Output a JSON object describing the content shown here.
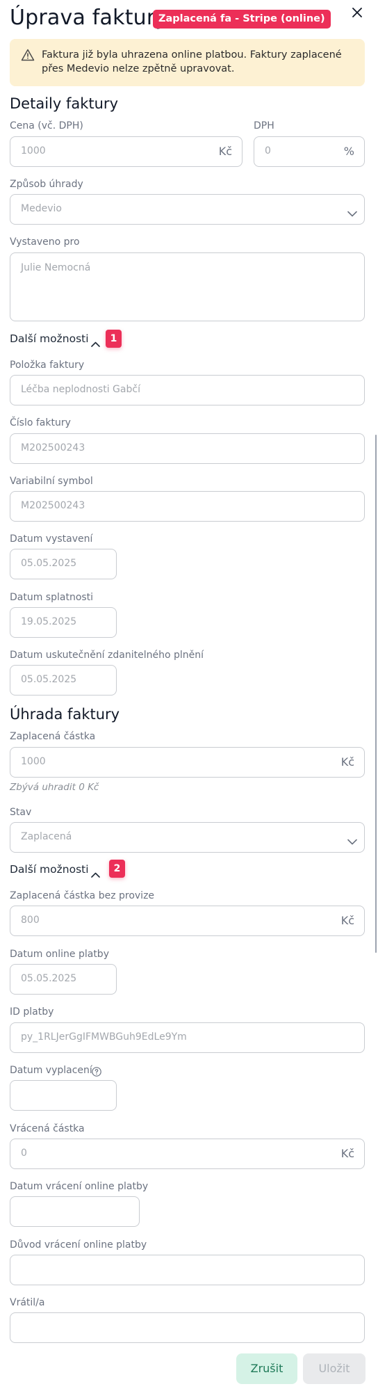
{
  "header": {
    "title": "Úprava faktury",
    "badge": "Zaplacená fa - Stripe (online)"
  },
  "alert": {
    "text": "Faktura již byla uhrazena online platbou. Faktury zaplacené přes Medevio nelze zpětně upravovat."
  },
  "invoice_details": {
    "title": "Detaily faktury",
    "price": {
      "label": "Cena (vč. DPH)",
      "value": "1000",
      "unit": "Kč"
    },
    "vat": {
      "label": "DPH",
      "value": "0",
      "unit": "%"
    },
    "payment_method": {
      "label": "Způsob úhrady",
      "value": "Medevio"
    },
    "issued_for": {
      "label": "Vystaveno pro",
      "value": "Julie Nemocná"
    },
    "more_options": {
      "label": "Další možnosti",
      "marker": "1"
    },
    "item": {
      "label": "Položka faktury",
      "value": "Léčba neplodnosti Gabčí"
    },
    "invoice_number": {
      "label": "Číslo faktury",
      "value": "M202500243"
    },
    "variable_symbol": {
      "label": "Variabilní symbol",
      "value": "M202500243"
    },
    "issue_date": {
      "label": "Datum vystavení",
      "value": "05.05.2025"
    },
    "due_date": {
      "label": "Datum splatnosti",
      "value": "19.05.2025"
    },
    "taxable_date": {
      "label": "Datum uskutečnění zdanitelného plnění",
      "value": "05.05.2025"
    }
  },
  "payment": {
    "title": "Úhrada faktury",
    "paid_amount": {
      "label": "Zaplacená částka",
      "value": "1000",
      "unit": "Kč"
    },
    "remaining": "Zbývá uhradit 0 Kč",
    "status": {
      "label": "Stav",
      "value": "Zaplacená"
    },
    "more_options": {
      "label": "Další možnosti",
      "marker": "2"
    },
    "paid_without_fee": {
      "label": "Zaplacená částka bez provize",
      "value": "800",
      "unit": "Kč"
    },
    "online_payment_date": {
      "label": "Datum online platby",
      "value": "05.05.2025"
    },
    "payment_id": {
      "label": "ID platby",
      "value": "py_1RLJerGgIFMWBGuh9EdLe9Ym"
    },
    "payout_date": {
      "label": "Datum vyplacení",
      "value": ""
    },
    "refunded_amount": {
      "label": "Vrácená částka",
      "value": "0",
      "unit": "Kč"
    },
    "refund_date": {
      "label": "Datum vrácení online platby",
      "value": ""
    },
    "refund_reason": {
      "label": "Důvod vrácení online platby",
      "value": ""
    },
    "refunded_by": {
      "label": "Vrátil/a",
      "value": ""
    }
  },
  "footer": {
    "cancel": "Zrušit",
    "save": "Uložit"
  },
  "colors": {
    "accent": "#ec2f58",
    "alert_bg": "#fdf1d3",
    "cancel_bg": "#d5f2e6",
    "save_disabled_bg": "#e9eaec"
  },
  "icons": [
    "close-icon",
    "warning-icon",
    "chevron-down-icon",
    "chevron-up-icon",
    "help-icon"
  ]
}
